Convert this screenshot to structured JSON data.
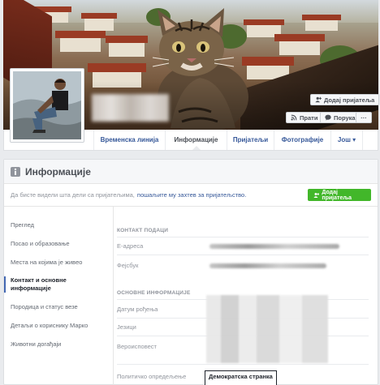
{
  "cover": {
    "add_friend_label": "Додај пријатеља",
    "follow_label": "Прати",
    "message_label": "Порука",
    "more_label": "···"
  },
  "nav": {
    "tabs": [
      {
        "label": "Временска линија"
      },
      {
        "label": "Информације"
      },
      {
        "label": "Пријатељи"
      },
      {
        "label": "Фотографије"
      },
      {
        "label": "Још ▾"
      }
    ]
  },
  "info": {
    "title": "Информације",
    "notice_text": "Да бисте видели шта дели са пријатељима,",
    "notice_link": "пошаљите му захтев за пријатељство.",
    "add_friend_label": "Додај пријатеља",
    "sidebar": [
      "Преглед",
      "Посао и образовање",
      "Места на којима је живео",
      "Контакт и основне информације",
      "Породица и статус везе",
      "Детаљи о кориснику Марко",
      "Животни догађаји"
    ],
    "contact_section": "КОНТАКТ ПОДАЦИ",
    "contact_fields": [
      "Е-адреса",
      "Фејсбук"
    ],
    "basic_section": "ОСНОВНЕ ИНФОРМАЦИЈЕ",
    "basic_fields": [
      "Датум рођења",
      "Језици",
      "Вероисповест"
    ],
    "political_label": "Политичко опредељење",
    "political_value": "Демократска странка"
  },
  "colors": {
    "link": "#365899",
    "green_button": "#42b72a",
    "accent": "#4267b2"
  },
  "icons": {
    "add_friend": "add-friend-icon",
    "follow": "rss-icon",
    "message": "message-icon",
    "info": "info-icon"
  }
}
